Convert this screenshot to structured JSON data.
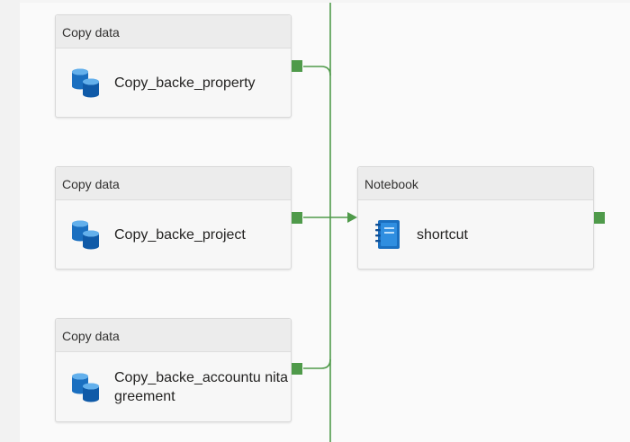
{
  "pipeline": {
    "activities": [
      {
        "type_label": "Copy data",
        "name": "Copy_backe_property",
        "icon": "copy-data-icon"
      },
      {
        "type_label": "Copy data",
        "name": "Copy_backe_project",
        "icon": "copy-data-icon"
      },
      {
        "type_label": "Copy data",
        "name": "Copy_backe_accountunitagreement",
        "name_display": "Copy_backe_accountu nitagreement",
        "icon": "copy-data-icon"
      },
      {
        "type_label": "Notebook",
        "name": "shortcut",
        "icon": "notebook-icon"
      }
    ]
  },
  "colors": {
    "success_connector": "#4f9a4a",
    "card_background": "#f7f7f7",
    "card_header": "#ececec",
    "icon_blue": "#1a6fc0"
  }
}
